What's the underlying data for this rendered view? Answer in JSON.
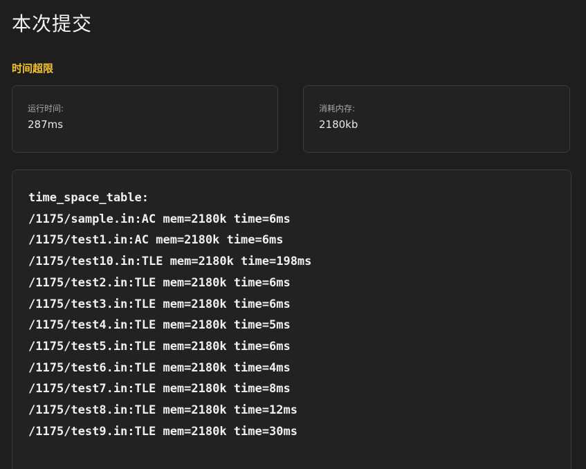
{
  "header": {
    "title": "本次提交"
  },
  "result": {
    "status": "时间超限",
    "status_color": "#f5c431"
  },
  "stats": {
    "runtime": {
      "label": "运行时间:",
      "value": "287ms"
    },
    "memory": {
      "label": "消耗内存:",
      "value": "2180kb"
    }
  },
  "output": {
    "lines": [
      "time_space_table:",
      "/1175/sample.in:AC mem=2180k time=6ms",
      "/1175/test1.in:AC mem=2180k time=6ms",
      "/1175/test10.in:TLE mem=2180k time=198ms",
      "/1175/test2.in:TLE mem=2180k time=6ms",
      "/1175/test3.in:TLE mem=2180k time=6ms",
      "/1175/test4.in:TLE mem=2180k time=5ms",
      "/1175/test5.in:TLE mem=2180k time=6ms",
      "/1175/test6.in:TLE mem=2180k time=4ms",
      "/1175/test7.in:TLE mem=2180k time=8ms",
      "/1175/test8.in:TLE mem=2180k time=12ms",
      "/1175/test9.in:TLE mem=2180k time=30ms"
    ]
  }
}
